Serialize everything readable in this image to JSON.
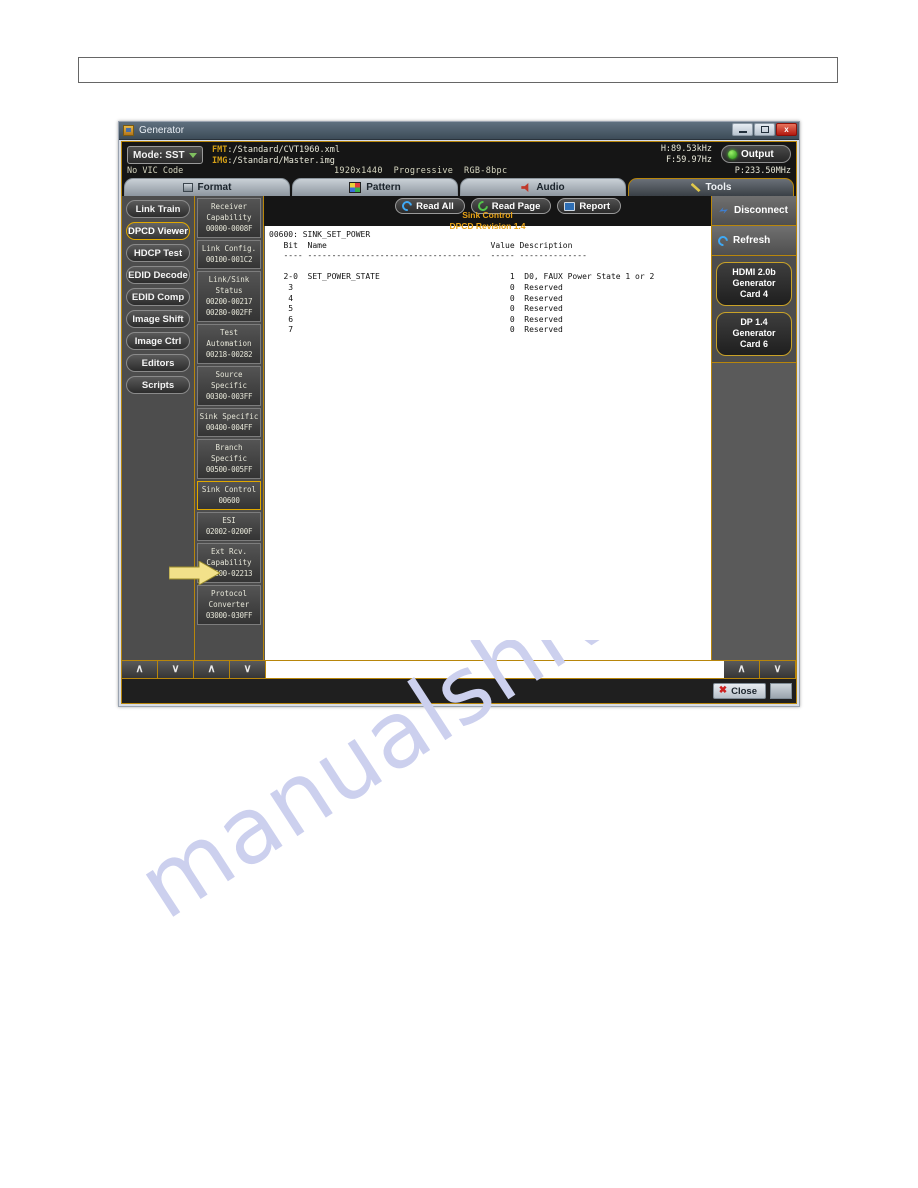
{
  "window": {
    "title": "Generator",
    "controls": {
      "minimize": "minimize-icon",
      "maximize": "maximize-icon",
      "close": "x"
    }
  },
  "status": {
    "mode_label": "Mode: SST",
    "fmt_key": "FMT",
    "fmt_value": ":/Standard/CVT1960.xml",
    "img_key": "IMG",
    "img_value": ":/Standard/Master.img",
    "vic": "No VIC Code",
    "resolution": "1920x1440",
    "scan": "Progressive",
    "colorimetry": "RGB-8bpc",
    "h_freq": "H:89.53kHz",
    "v_freq": "F:59.97Hz",
    "pixel_clock": "P:233.50MHz",
    "output_label": "Output"
  },
  "tabs": [
    {
      "label": "Format",
      "icon": "monitor-icon",
      "active": false
    },
    {
      "label": "Pattern",
      "icon": "color-bars-icon",
      "active": false
    },
    {
      "label": "Audio",
      "icon": "speaker-icon",
      "active": false
    },
    {
      "label": "Tools",
      "icon": "tools-icon",
      "active": true
    }
  ],
  "nav": {
    "items": [
      {
        "label": "Link Train",
        "active": false
      },
      {
        "label": "DPCD Viewer",
        "active": true
      },
      {
        "label": "HDCP Test",
        "active": false
      },
      {
        "label": "EDID Decode",
        "active": false
      },
      {
        "label": "EDID Comp",
        "active": false
      },
      {
        "label": "Image Shift",
        "active": false
      },
      {
        "label": "Image Ctrl",
        "active": false
      },
      {
        "label": "Editors",
        "active": false
      },
      {
        "label": "Scripts",
        "active": false
      }
    ]
  },
  "ranges": {
    "items": [
      {
        "name": "Receiver Capability",
        "code": "00000-0008F",
        "code2": "",
        "active": false
      },
      {
        "name": "Link Config.",
        "code": "00100-001C2",
        "code2": "",
        "active": false
      },
      {
        "name": "Link/Sink Status",
        "code": "00200-00217",
        "code2": "00280-002FF",
        "active": false
      },
      {
        "name": "Test Automation",
        "code": "00218-00282",
        "code2": "",
        "active": false
      },
      {
        "name": "Source Specific",
        "code": "00300-003FF",
        "code2": "",
        "active": false
      },
      {
        "name": "Sink Specific",
        "code": "00400-004FF",
        "code2": "",
        "active": false
      },
      {
        "name": "Branch Specific",
        "code": "00500-005FF",
        "code2": "",
        "active": false
      },
      {
        "name": "Sink Control",
        "code": "00600",
        "code2": "",
        "active": true
      },
      {
        "name": "ESI",
        "code": "02002-0200F",
        "code2": "",
        "active": false
      },
      {
        "name": "Ext Rcv. Capability",
        "code": "02200-02213",
        "code2": "",
        "active": false
      },
      {
        "name": "Protocol Converter",
        "code": "03000-030FF",
        "code2": "",
        "active": false
      }
    ]
  },
  "toolbar": {
    "read_all": "Read All",
    "read_page": "Read Page",
    "report": "Report",
    "sub_title_1": "Sink Control",
    "sub_title_2": "DPCD Revision 1.4"
  },
  "document": {
    "text": "00600: SINK_SET_POWER\n   Bit  Name                                  Value Description\n   ---- ------------------------------------  ----- --------------\n\n   2-0  SET_POWER_STATE                           1  D0, FAUX Power State 1 or 2\n    3                                             0  Reserved\n    4                                             0  Reserved\n    5                                             0  Reserved\n    6                                             0  Reserved\n    7                                             0  Reserved"
  },
  "right_panel": {
    "disconnect": "Disconnect",
    "refresh": "Refresh",
    "cards": [
      {
        "line1": "HDMI 2.0b",
        "line2": "Generator",
        "line3": "Card 4"
      },
      {
        "line1": "DP 1.4",
        "line2": "Generator",
        "line3": "Card 6"
      }
    ]
  },
  "bottom": {
    "scroll_up": "∧",
    "scroll_down": "∨",
    "close": "Close"
  },
  "annotation": {
    "arrow_color": "#f2e18a",
    "arrow_target": "ESI"
  },
  "page": {
    "watermark": "manualshive.com"
  }
}
